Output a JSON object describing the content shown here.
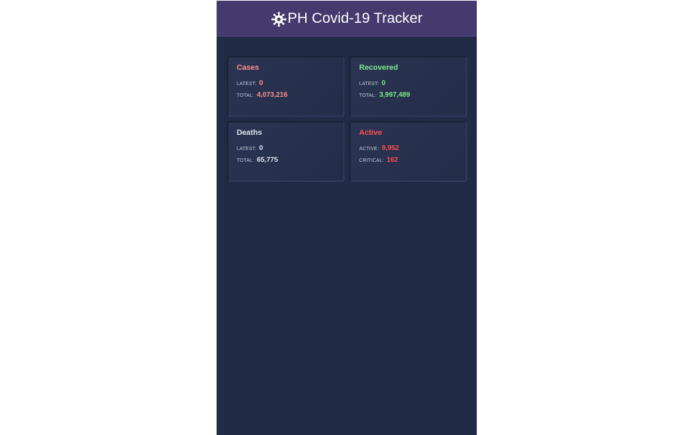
{
  "header": {
    "title": "PH Covid-19 Tracker",
    "icon": "virus-icon"
  },
  "cards": {
    "cases": {
      "title": "Cases",
      "latest_label": "Latest:",
      "latest_value": "0",
      "total_label": "Total:",
      "total_value": "4,073,216",
      "color": "#ff8f8f"
    },
    "recovered": {
      "title": "Recovered",
      "latest_label": "Latest:",
      "latest_value": "0",
      "total_label": "Total:",
      "total_value": "3,997,489",
      "color": "#7ee88c"
    },
    "deaths": {
      "title": "Deaths",
      "latest_label": "Latest:",
      "latest_value": "0",
      "total_label": "Total:",
      "total_value": "65,775",
      "color": "#dde1ef"
    },
    "active": {
      "title": "Active",
      "active_label": "Active:",
      "active_value": "9,952",
      "critical_label": "Critical:",
      "critical_value": "162",
      "color": "#ff4d4d"
    }
  },
  "colors": {
    "header_bg": "#443a6e",
    "app_bg": "#222b45"
  }
}
